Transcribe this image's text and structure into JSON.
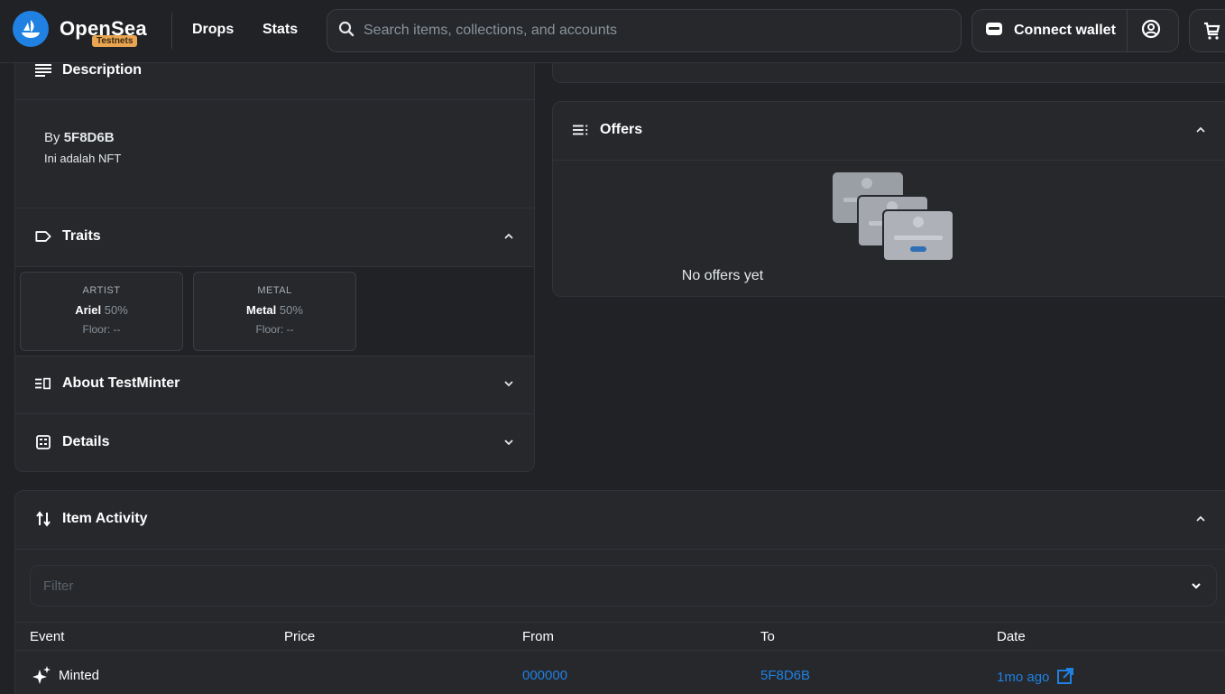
{
  "header": {
    "logo_text": "OpenSea",
    "badge": "Testnets",
    "nav": [
      "Drops",
      "Stats"
    ],
    "search_placeholder": "Search items, collections, and accounts",
    "connect_wallet": "Connect wallet",
    "icons": [
      "opensea-logo-icon",
      "search-icon",
      "wallet-icon",
      "profile-icon",
      "cart-icon"
    ]
  },
  "description": {
    "title": "Description",
    "by_prefix": "By",
    "creator": "5F8D6B",
    "text": "Ini adalah NFT"
  },
  "traits": {
    "title": "Traits",
    "items": [
      {
        "type": "ARTIST",
        "value": "Ariel",
        "percent": "50%",
        "floor": "Floor: --"
      },
      {
        "type": "METAL",
        "value": "Metal",
        "percent": "50%",
        "floor": "Floor: --"
      }
    ]
  },
  "about": {
    "title": "About TestMinter"
  },
  "details": {
    "title": "Details"
  },
  "offers": {
    "title": "Offers",
    "empty_text": "No offers yet"
  },
  "activity": {
    "title": "Item Activity",
    "filter_placeholder": "Filter",
    "columns": [
      "Event",
      "Price",
      "From",
      "To",
      "Date"
    ],
    "rows": [
      {
        "event": "Minted",
        "price": "",
        "from": "000000",
        "to": "5F8D6B",
        "date": "1mo ago"
      }
    ]
  },
  "colors": {
    "accent": "#2081e2",
    "background": "#202225",
    "panel": "#26282c",
    "badge": "#e9a552"
  }
}
